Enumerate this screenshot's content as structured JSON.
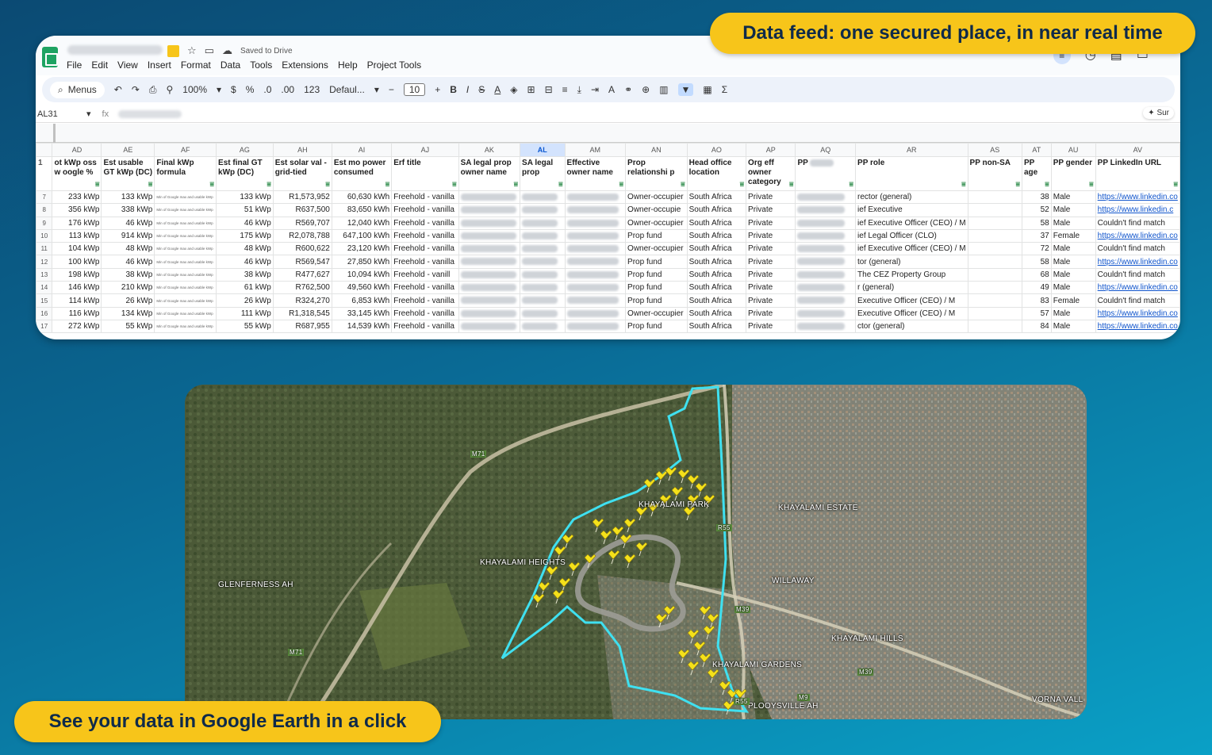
{
  "callouts": {
    "top": "Data feed: one secured place, in near real time",
    "bottom": "See your data in Google Earth in a click"
  },
  "sheet": {
    "saved_status": "Saved to Drive",
    "menus": [
      "File",
      "Edit",
      "View",
      "Insert",
      "Format",
      "Data",
      "Tools",
      "Extensions",
      "Help",
      "Project Tools"
    ],
    "toolbar": {
      "search": "Menus",
      "zoom": "100%",
      "currency": "$",
      "percent": "%",
      "dec_less": ".0",
      "dec_more": ".00",
      "number_fmt": "123",
      "font": "Defaul...",
      "font_size": "10"
    },
    "name_box": "AL31",
    "fx": "fx",
    "sum_button": "Sur",
    "col_letters": [
      "AD",
      "AE",
      "AF",
      "AG",
      "AH",
      "AI",
      "AJ",
      "AK",
      "AL",
      "AM",
      "AN",
      "AO",
      "AP",
      "AQ",
      "AR",
      "AS",
      "AT",
      "AU",
      "AV"
    ],
    "headers": [
      "ot kWp oss w oogle %",
      "Est usable GT kWp (DC)",
      "Final kWp formula",
      "Est final GT kWp (DC)",
      "Est solar val - grid-tied",
      "Est mo power consumed",
      "Erf title",
      "SA legal prop owner name",
      "SA legal prop",
      "Effective owner name",
      "Prop relationshi p",
      "Head office location",
      "Org eff owner category",
      "PP name",
      "PP role",
      "PP non-SA",
      "PP age",
      "PP gender",
      "PP LinkedIn URL"
    ],
    "formula_note": "Min of Google max and usable kWp",
    "rows": [
      {
        "n": "7",
        "ad": "233 kWp",
        "ae": "133 kWp",
        "ag": "133 kWp",
        "ah": "R1,573,952",
        "ai": "60,630 kWh",
        "aj": "Freehold - vanilla",
        "an": "Owner-occupier",
        "ao": "South Africa",
        "ap": "Private",
        "ar": "rector (general)",
        "at": "38",
        "au": "Male",
        "av": "https://www.linkedin.co",
        "link": true
      },
      {
        "n": "8",
        "ad": "356 kWp",
        "ae": "338 kWp",
        "ag": "51 kWp",
        "ah": "R637,500",
        "ai": "83,650 kWh",
        "aj": "Freehold - vanilla",
        "an": "Owner-occupie",
        "ao": "South Africa",
        "ap": "Private",
        "ar": "ief Executive",
        "at": "52",
        "au": "Male",
        "av": "https://www.linkedin.c",
        "link": true
      },
      {
        "n": "9",
        "ad": "176 kWp",
        "ae": "46 kWp",
        "ag": "46 kWp",
        "ah": "R569,707",
        "ai": "12,040 kWh",
        "aj": "Freehold - vanilla",
        "an": "Owner-occupier",
        "ao": "South Africa",
        "ap": "Private",
        "ar": "ief Executive Officer (CEO) / M",
        "at": "58",
        "au": "Male",
        "av": "Couldn't find match",
        "link": false
      },
      {
        "n": "10",
        "ad": "113 kWp",
        "ae": "914 kWp",
        "ag": "175 kWp",
        "ah": "R2,078,788",
        "ai": "647,100 kWh",
        "aj": "Freehold - vanilla",
        "an": "Prop fund",
        "ao": "South Africa",
        "ap": "Private",
        "ar": "ief Legal Officer (CLO)",
        "at": "37",
        "au": "Female",
        "av": "https://www.linkedin.co",
        "link": true
      },
      {
        "n": "11",
        "ad": "104 kWp",
        "ae": "48 kWp",
        "ag": "48 kWp",
        "ah": "R600,622",
        "ai": "23,120 kWh",
        "aj": "Freehold - vanilla",
        "an": "Owner-occupier",
        "ao": "South Africa",
        "ap": "Private",
        "ar": "ief Executive Officer (CEO) / M",
        "at": "72",
        "au": "Male",
        "av": "Couldn't find match",
        "link": false
      },
      {
        "n": "12",
        "ad": "100 kWp",
        "ae": "46 kWp",
        "ag": "46 kWp",
        "ah": "R569,547",
        "ai": "27,850 kWh",
        "aj": "Freehold - vanilla",
        "an": "Prop fund",
        "ao": "South Africa",
        "ap": "Private",
        "ar": "tor (general)",
        "at": "58",
        "au": "Male",
        "av": "https://www.linkedin.co",
        "link": true
      },
      {
        "n": "13",
        "ad": "198 kWp",
        "ae": "38 kWp",
        "ag": "38 kWp",
        "ah": "R477,627",
        "ai": "10,094 kWh",
        "aj": "Freehold - vanill",
        "an": "Prop fund",
        "ao": "South Africa",
        "ap": "Private",
        "ar": "The CEZ Property Group",
        "at": "68",
        "au": "Male",
        "av": "Couldn't find match",
        "link": false
      },
      {
        "n": "14",
        "ad": "146 kWp",
        "ae": "210 kWp",
        "ag": "61 kWp",
        "ah": "R762,500",
        "ai": "49,560 kWh",
        "aj": "Freehold - vanilla",
        "an": "Prop fund",
        "ao": "South Africa",
        "ap": "Private",
        "ar": "r (general)",
        "at": "49",
        "au": "Male",
        "av": "https://www.linkedin.co",
        "link": true
      },
      {
        "n": "15",
        "ad": "114 kWp",
        "ae": "26 kWp",
        "ag": "26 kWp",
        "ah": "R324,270",
        "ai": "6,853 kWh",
        "aj": "Freehold - vanilla",
        "an": "Prop fund",
        "ao": "South Africa",
        "ap": "Private",
        "ar": "Executive Officer (CEO) / M",
        "at": "83",
        "au": "Female",
        "av": "Couldn't find match",
        "link": false
      },
      {
        "n": "16",
        "ad": "116 kWp",
        "ae": "134 kWp",
        "ag": "111 kWp",
        "ah": "R1,318,545",
        "ai": "33,145 kWh",
        "aj": "Freehold - vanilla",
        "an": "Owner-occupier",
        "ao": "South Africa",
        "ap": "Private",
        "ar": "Executive Officer (CEO) / M",
        "at": "57",
        "au": "Male",
        "av": "https://www.linkedin.co",
        "link": true
      },
      {
        "n": "17",
        "ad": "272 kWp",
        "ae": "55 kWp",
        "ag": "55 kWp",
        "ah": "R687,955",
        "ai": "14,539 kWh",
        "aj": "Freehold - vanilla",
        "an": "Prop fund",
        "ao": "South Africa",
        "ap": "Private",
        "ar": "ctor (general)",
        "at": "84",
        "au": "Male",
        "av": "https://www.linkedin.co",
        "link": true
      }
    ]
  },
  "map": {
    "labels": [
      "KHAYALAMI PARK",
      "KHAYALAMI ESTATE",
      "KHAYALAMI HEIGHTS",
      "GLENFERNESS AH",
      "WILLAWAY",
      "KHAYALAMI HILLS",
      "KHAYALAMI GARDENS",
      "PLOOYSVILLE AH",
      "VORNA VALL"
    ],
    "road_labels": [
      "M71",
      "M71",
      "R55",
      "M39",
      "M39",
      "R55",
      "M9"
    ],
    "boundary_color": "#3fe0f0",
    "pin_color": "#f5e11a"
  },
  "colors": {
    "callout_bg": "#f7c51a",
    "callout_text": "#0f2a4a",
    "sheets_green": "#1ea362",
    "link_blue": "#1155cc"
  }
}
